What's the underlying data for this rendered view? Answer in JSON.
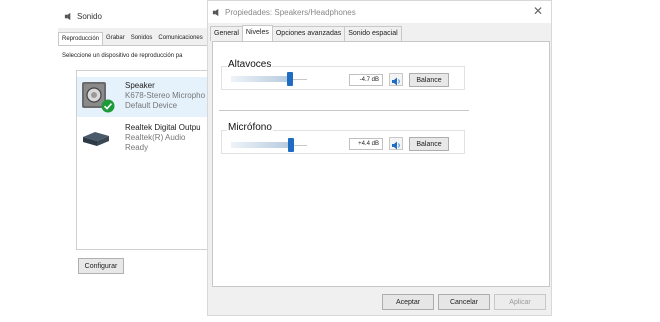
{
  "sonido": {
    "title": "Sonido",
    "tabs": [
      "Reproducción",
      "Grabar",
      "Sonidos",
      "Comunicaciones"
    ],
    "hint": "Seleccione un dispositivo de reproducción pa",
    "devices": [
      {
        "name": "Speaker",
        "desc": "K678-Stereo Micropho",
        "status": "Default Device",
        "selected": true
      },
      {
        "name": "Realtek Digital Outpu",
        "desc": "Realtek(R) Audio",
        "status": "Ready",
        "selected": false
      }
    ],
    "configure_label": "Configurar"
  },
  "props": {
    "title": "Propiedades: Speakers/Headphones",
    "close_glyph": "✕",
    "tabs": [
      "General",
      "Niveles",
      "Opciones avanzadas",
      "Sonido espacial"
    ],
    "active_tab": "Niveles",
    "levels": [
      {
        "label": "Altavoces",
        "value": "-4.7 dB",
        "level": 0.8,
        "balance_label": "Balance"
      },
      {
        "label": "Micrófono",
        "value": "+4.4 dB",
        "level": 0.82,
        "balance_label": "Balance"
      }
    ],
    "buttons": {
      "accept": "Aceptar",
      "cancel": "Cancelar",
      "apply": "Aplicar"
    }
  },
  "colors": {
    "accent": "#1f6dc2",
    "check": "#1e9a3a",
    "selected_row": "#e5f1fb"
  }
}
